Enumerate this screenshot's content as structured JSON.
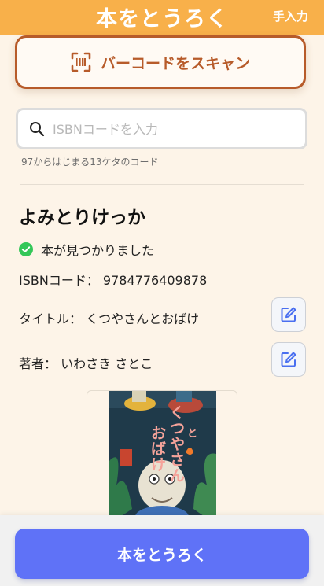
{
  "header": {
    "title": "本をとうろく",
    "manual_label": "手入力"
  },
  "scan": {
    "label": "バーコードをスキャン",
    "icon": "barcode-scan-icon"
  },
  "search": {
    "placeholder": "ISBNコードを入力",
    "value": "",
    "hint": "97からはじまる13ケタのコード",
    "icon": "search-icon"
  },
  "book": {
    "heading": "よみとりけっか",
    "status": "本が見つかりました",
    "status_icon": "check-circle-icon",
    "isbn_label": "ISBNコード：",
    "isbn_value": "9784776409878",
    "title_label": "タイトル：",
    "title_value": "くつやさんとおばけ",
    "author_label": "著者：",
    "author_value": "いわさき さとこ",
    "cover_title": "くつやさんとおばけ"
  },
  "register": {
    "label": "本をとうろく"
  },
  "colors": {
    "header": "#f8b04a",
    "scan_accent": "#b75b2a",
    "background": "#fdf4e8",
    "primary": "#5f72f7",
    "success": "#34c759",
    "edit_icon": "#4a6ff0"
  }
}
